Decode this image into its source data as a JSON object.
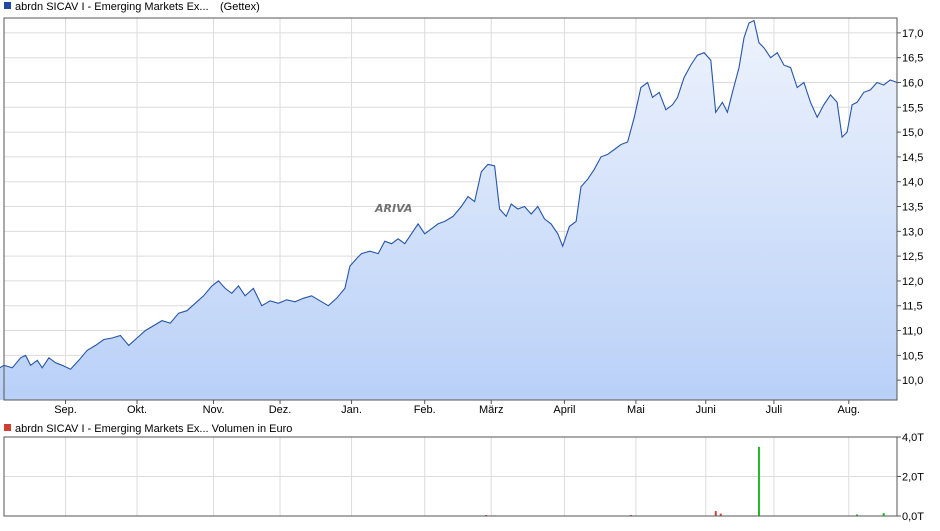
{
  "colors": {
    "price_line": "#2655a8",
    "area_top": "#eef3fd",
    "area_bottom": "#b9d0f7",
    "grid": "#dcdcdc",
    "axis": "#555555",
    "legend_price": "#1f4aa0",
    "legend_volume": "#d04030",
    "volume_red": "#d04040",
    "volume_green": "#22bb22"
  },
  "chart_data": [
    {
      "type": "area",
      "legend": {
        "label": "abrdn SICAV I - Emerging Markets Ex...",
        "source": "(Gettex)",
        "placement": "top-left"
      },
      "y_axis": {
        "position": "right",
        "ylim": [
          9.6,
          17.3
        ],
        "ticks": [
          10.0,
          10.5,
          11.0,
          11.5,
          12.0,
          12.5,
          13.0,
          13.5,
          14.0,
          14.5,
          15.0,
          15.5,
          16.0,
          16.5,
          17.0
        ],
        "tick_labels": [
          "10,0",
          "10,5",
          "11,0",
          "11,5",
          "12,0",
          "12,5",
          "13,0",
          "13,5",
          "14,0",
          "14,5",
          "15,0",
          "15,5",
          "16,0",
          "16,5",
          "17,0"
        ]
      },
      "x_axis": {
        "range": [
          0,
          52
        ],
        "ticks": [
          {
            "label": "Sep.",
            "week": 4.2
          },
          {
            "label": "Okt.",
            "week": 8.5
          },
          {
            "label": "Nov.",
            "week": 13.1
          },
          {
            "label": "Dez.",
            "week": 17.1
          },
          {
            "label": "Jan.",
            "week": 21.4
          },
          {
            "label": "Feb.",
            "week": 25.8
          },
          {
            "label": "März",
            "week": 29.8
          },
          {
            "label": "April",
            "week": 34.2
          },
          {
            "label": "Mai",
            "week": 38.5
          },
          {
            "label": "Juni",
            "week": 42.7
          },
          {
            "label": "Juli",
            "week": 46.8
          },
          {
            "label": "Aug.",
            "week": 51.3
          }
        ]
      },
      "grid": true,
      "series": [
        {
          "values": [
            [
              0.0,
              10.2
            ],
            [
              0.5,
              10.3
            ],
            [
              1.0,
              10.25
            ],
            [
              1.5,
              10.45
            ],
            [
              1.8,
              10.5
            ],
            [
              2.1,
              10.3
            ],
            [
              2.5,
              10.4
            ],
            [
              2.8,
              10.25
            ],
            [
              3.2,
              10.45
            ],
            [
              3.6,
              10.35
            ],
            [
              4.0,
              10.3
            ],
            [
              4.5,
              10.22
            ],
            [
              5.0,
              10.4
            ],
            [
              5.5,
              10.6
            ],
            [
              6.0,
              10.7
            ],
            [
              6.5,
              10.82
            ],
            [
              7.0,
              10.85
            ],
            [
              7.5,
              10.9
            ],
            [
              8.0,
              10.7
            ],
            [
              8.5,
              10.85
            ],
            [
              9.0,
              11.0
            ],
            [
              9.5,
              11.1
            ],
            [
              10.0,
              11.2
            ],
            [
              10.5,
              11.15
            ],
            [
              11.0,
              11.35
            ],
            [
              11.5,
              11.4
            ],
            [
              12.0,
              11.55
            ],
            [
              12.5,
              11.7
            ],
            [
              13.0,
              11.9
            ],
            [
              13.4,
              12.0
            ],
            [
              13.8,
              11.85
            ],
            [
              14.2,
              11.75
            ],
            [
              14.6,
              11.9
            ],
            [
              15.0,
              11.7
            ],
            [
              15.5,
              11.85
            ],
            [
              16.0,
              11.5
            ],
            [
              16.5,
              11.6
            ],
            [
              17.0,
              11.55
            ],
            [
              17.5,
              11.62
            ],
            [
              18.0,
              11.58
            ],
            [
              18.5,
              11.65
            ],
            [
              19.0,
              11.7
            ],
            [
              19.5,
              11.6
            ],
            [
              20.0,
              11.5
            ],
            [
              20.5,
              11.65
            ],
            [
              21.0,
              11.85
            ],
            [
              21.3,
              12.3
            ],
            [
              21.7,
              12.45
            ],
            [
              22.0,
              12.55
            ],
            [
              22.5,
              12.6
            ],
            [
              23.0,
              12.55
            ],
            [
              23.4,
              12.8
            ],
            [
              23.8,
              12.75
            ],
            [
              24.2,
              12.85
            ],
            [
              24.6,
              12.75
            ],
            [
              25.0,
              12.95
            ],
            [
              25.4,
              13.15
            ],
            [
              25.8,
              12.95
            ],
            [
              26.2,
              13.05
            ],
            [
              26.6,
              13.15
            ],
            [
              27.0,
              13.2
            ],
            [
              27.5,
              13.3
            ],
            [
              28.0,
              13.5
            ],
            [
              28.4,
              13.7
            ],
            [
              28.8,
              13.6
            ],
            [
              29.2,
              14.2
            ],
            [
              29.6,
              14.35
            ],
            [
              30.0,
              14.32
            ],
            [
              30.3,
              13.45
            ],
            [
              30.7,
              13.3
            ],
            [
              31.0,
              13.55
            ],
            [
              31.4,
              13.45
            ],
            [
              31.8,
              13.5
            ],
            [
              32.2,
              13.35
            ],
            [
              32.6,
              13.5
            ],
            [
              33.0,
              13.25
            ],
            [
              33.4,
              13.15
            ],
            [
              33.8,
              12.95
            ],
            [
              34.1,
              12.7
            ],
            [
              34.5,
              13.1
            ],
            [
              34.9,
              13.2
            ],
            [
              35.2,
              13.9
            ],
            [
              35.6,
              14.05
            ],
            [
              36.0,
              14.25
            ],
            [
              36.4,
              14.5
            ],
            [
              36.8,
              14.55
            ],
            [
              37.2,
              14.65
            ],
            [
              37.6,
              14.75
            ],
            [
              38.0,
              14.8
            ],
            [
              38.4,
              15.3
            ],
            [
              38.8,
              15.9
            ],
            [
              39.2,
              16.0
            ],
            [
              39.5,
              15.7
            ],
            [
              39.9,
              15.8
            ],
            [
              40.3,
              15.45
            ],
            [
              40.7,
              15.55
            ],
            [
              41.0,
              15.7
            ],
            [
              41.4,
              16.1
            ],
            [
              41.8,
              16.35
            ],
            [
              42.2,
              16.55
            ],
            [
              42.6,
              16.6
            ],
            [
              43.0,
              16.45
            ],
            [
              43.3,
              15.4
            ],
            [
              43.7,
              15.6
            ],
            [
              44.0,
              15.4
            ],
            [
              44.3,
              15.8
            ],
            [
              44.7,
              16.3
            ],
            [
              45.0,
              16.9
            ],
            [
              45.3,
              17.2
            ],
            [
              45.6,
              17.25
            ],
            [
              45.9,
              16.8
            ],
            [
              46.2,
              16.7
            ],
            [
              46.6,
              16.5
            ],
            [
              47.0,
              16.6
            ],
            [
              47.4,
              16.35
            ],
            [
              47.8,
              16.3
            ],
            [
              48.2,
              15.9
            ],
            [
              48.6,
              16.0
            ],
            [
              49.0,
              15.6
            ],
            [
              49.4,
              15.3
            ],
            [
              49.8,
              15.55
            ],
            [
              50.2,
              15.75
            ],
            [
              50.6,
              15.6
            ],
            [
              50.9,
              14.9
            ],
            [
              51.2,
              15.0
            ],
            [
              51.5,
              15.55
            ],
            [
              51.8,
              15.6
            ],
            [
              52.2,
              15.8
            ],
            [
              52.6,
              15.85
            ],
            [
              53.0,
              16.0
            ],
            [
              53.4,
              15.95
            ],
            [
              53.8,
              16.05
            ],
            [
              54.2,
              16.0
            ]
          ]
        }
      ]
    },
    {
      "type": "bar",
      "legend": {
        "label": "abrdn SICAV I - Emerging Markets Ex... Volumen in Euro",
        "placement": "top-left"
      },
      "y_axis": {
        "position": "right",
        "ylim": [
          0,
          4.0
        ],
        "ticks": [
          0,
          2,
          4
        ],
        "tick_labels": [
          "0,0T",
          "2,0T",
          "4,0T"
        ]
      },
      "grid": true,
      "series": [
        {
          "values": [
            {
              "week": 29.5,
              "value": 0.05,
              "color": "volume_red"
            },
            {
              "week": 30.0,
              "value": 0.03,
              "color": "volume_red"
            },
            {
              "week": 38.2,
              "value": 0.05,
              "color": "volume_red"
            },
            {
              "week": 43.3,
              "value": 0.25,
              "color": "volume_red"
            },
            {
              "week": 43.6,
              "value": 0.12,
              "color": "volume_red"
            },
            {
              "week": 45.9,
              "value": 3.5,
              "color": "volume_green"
            },
            {
              "week": 51.8,
              "value": 0.08,
              "color": "volume_green"
            },
            {
              "week": 53.4,
              "value": 0.15,
              "color": "volume_green"
            }
          ]
        }
      ]
    }
  ]
}
